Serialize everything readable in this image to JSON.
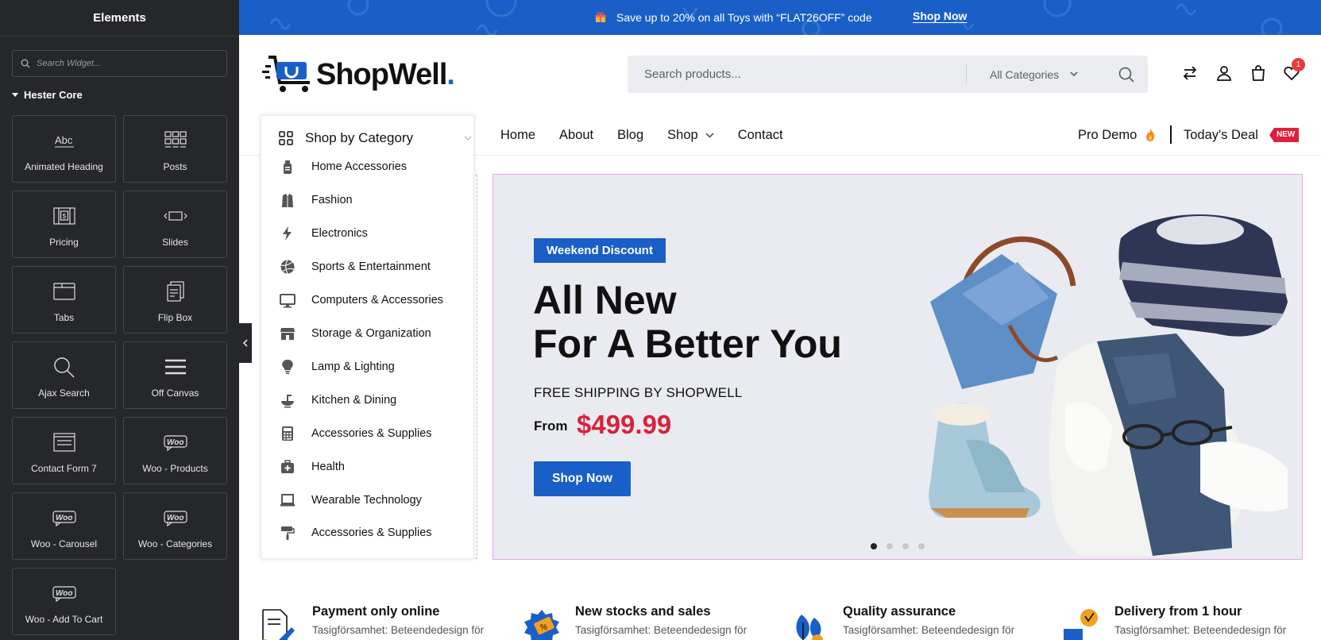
{
  "panel": {
    "title": "Elements",
    "search_placeholder": "Search Widget...",
    "category": "Hester Core",
    "widgets": [
      {
        "label": "Animated Heading",
        "icon": "animated-heading-icon"
      },
      {
        "label": "Posts",
        "icon": "posts-grid-icon"
      },
      {
        "label": "Pricing",
        "icon": "pricing-icon"
      },
      {
        "label": "Slides",
        "icon": "slides-icon"
      },
      {
        "label": "Tabs",
        "icon": "tabs-icon"
      },
      {
        "label": "Flip Box",
        "icon": "flip-box-icon"
      },
      {
        "label": "Ajax Search",
        "icon": "search-icon"
      },
      {
        "label": "Off Canvas",
        "icon": "hamburger-icon"
      },
      {
        "label": "Contact Form 7",
        "icon": "form-icon"
      },
      {
        "label": "Woo - Products",
        "icon": "woo-icon"
      },
      {
        "label": "Woo - Carousel",
        "icon": "woo-icon"
      },
      {
        "label": "Woo - Categories",
        "icon": "woo-icon"
      },
      {
        "label": "Woo - Add To Cart",
        "icon": "woo-icon"
      }
    ]
  },
  "promo": {
    "text": "Save up to 20% on all Toys with “FLAT26OFF” code",
    "link": "Shop Now",
    "icon": "gift-icon"
  },
  "header": {
    "logo_text": "ShopWell",
    "logo_dot": ".",
    "search_placeholder": "Search products...",
    "category_select": "All Categories",
    "wishlist_count": "1",
    "icons": [
      "compare-icon",
      "user-icon",
      "bag-icon",
      "heart-icon"
    ]
  },
  "category_menu": {
    "title": "Shop by Category",
    "items": [
      {
        "label": "Home Accessories",
        "icon": "home-accessories-icon"
      },
      {
        "label": "Fashion",
        "icon": "fashion-icon"
      },
      {
        "label": "Electronics",
        "icon": "lightning-icon"
      },
      {
        "label": "Sports & Entertainment",
        "icon": "volleyball-icon"
      },
      {
        "label": "Computers & Accessories",
        "icon": "monitor-icon"
      },
      {
        "label": "Storage & Organization",
        "icon": "store-icon"
      },
      {
        "label": "Lamp & Lighting",
        "icon": "bulb-icon"
      },
      {
        "label": "Kitchen & Dining",
        "icon": "kitchen-icon"
      },
      {
        "label": "Accessories & Supplies",
        "icon": "calculator-icon"
      },
      {
        "label": "Health",
        "icon": "health-icon"
      },
      {
        "label": "Wearable Technology",
        "icon": "laptop-icon"
      },
      {
        "label": "Accessories & Supplies",
        "icon": "paint-roller-icon"
      }
    ]
  },
  "nav": {
    "items": [
      "Home",
      "About",
      "Blog",
      "Shop",
      "Contact"
    ],
    "pro_demo": "Pro Demo",
    "todays_deal": "Today's Deal",
    "new_badge": "NEW"
  },
  "hero": {
    "badge": "Weekend Discount",
    "title_line1": "All New",
    "title_line2": "For A Better You",
    "subtitle": "FREE SHIPPING BY SHOPWELL",
    "from_label": "From",
    "price": "$499.99",
    "button": "Shop Now",
    "slides": 4,
    "active_slide": 1
  },
  "features": [
    {
      "title": "Payment only online",
      "desc": "Tasigförsamhet: Beteendedesign för"
    },
    {
      "title": "New stocks and sales",
      "desc": "Tasigförsamhet: Beteendedesign för"
    },
    {
      "title": "Quality assurance",
      "desc": "Tasigförsamhet: Beteendedesign för"
    },
    {
      "title": "Delivery from 1 hour",
      "desc": "Tasigförsamhet: Beteendedesign för"
    }
  ],
  "colors": {
    "brand_blue": "#1a5fc7",
    "price_red": "#d8223a",
    "panel_bg": "#26272b"
  }
}
